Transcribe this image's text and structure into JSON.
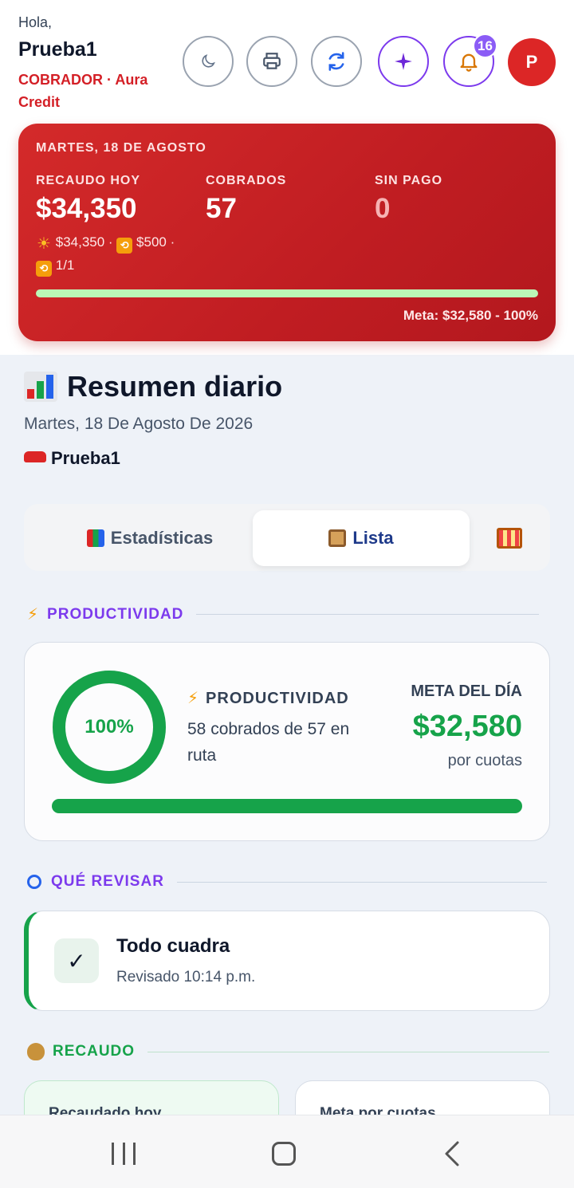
{
  "header": {
    "greeting": "Hola,",
    "username": "Prueba1",
    "role": "COBRADOR · Aura Credit",
    "notifications_count": "16",
    "avatar_initial": "P",
    "buttons": [
      "moon-icon",
      "printer-icon",
      "refresh-icon",
      "sparkle-icon",
      "bell-icon"
    ]
  },
  "summary_card": {
    "date": "MARTES, 18 DE AGOSTO",
    "recaudo_label": "RECAUDO HOY",
    "recaudo_value": "$34,350",
    "cobrados_label": "COBRADOS",
    "cobrados_value": "57",
    "sinpago_label": "SIN PAGO",
    "sinpago_value": "0",
    "breakdown_1": "$34,350",
    "breakdown_2": "$500",
    "breakdown_3": "1/1",
    "progress": 1.0,
    "meta_text": "Meta: $32,580 - 100%"
  },
  "page": {
    "title": "Resumen diario",
    "date": "Martes, 18 De Agosto De 2026",
    "route": "Prueba1"
  },
  "tabs": [
    {
      "label": "Estadísticas",
      "active": false
    },
    {
      "label": "Lista",
      "active": true
    },
    {
      "label": "",
      "active": false
    }
  ],
  "productividad": {
    "section_title": "PRODUCTIVIDAD",
    "ring_percent": "100%",
    "ring_fraction": 1.0,
    "label": "PRODUCTIVIDAD",
    "description": "58 cobrados de 57 en ruta",
    "meta_label": "META DEL DÍA",
    "meta_value": "$32,580",
    "meta_sub": "por cuotas",
    "progress": 1.0
  },
  "revisar": {
    "section_title": "QUÉ REVISAR",
    "title": "Todo cuadra",
    "subtitle": "Revisado 10:14 p.m."
  },
  "recaudo": {
    "section_title": "RECAUDO",
    "card_1": "Recaudado hoy",
    "card_2": "Meta por cuotas"
  },
  "colors": {
    "primary_red": "#d41f26",
    "accent_purple": "#7c3aed",
    "success_green": "#16a34a"
  }
}
